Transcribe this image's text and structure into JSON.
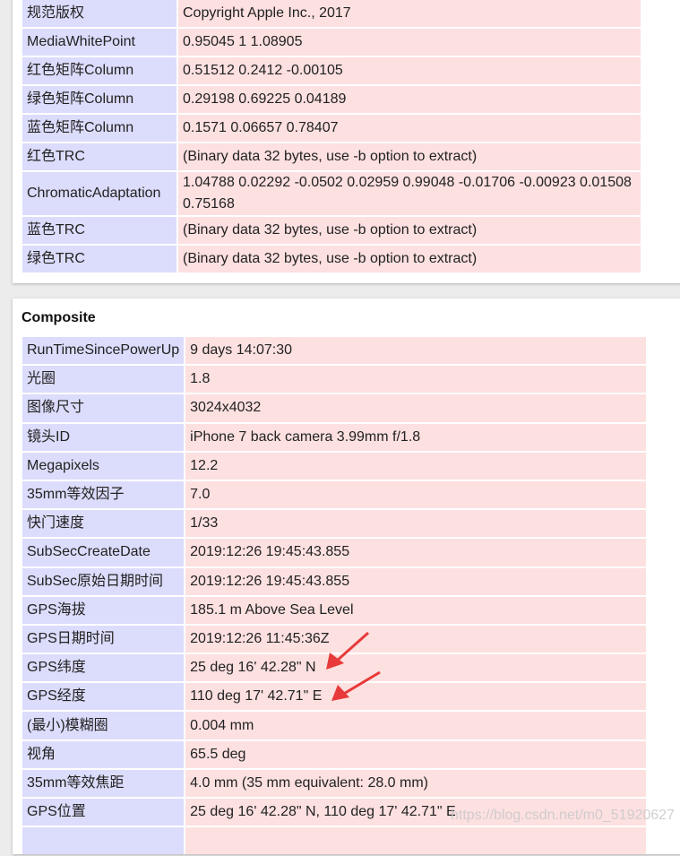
{
  "icc_rows": [
    {
      "key": "规范版权",
      "value": "Copyright Apple Inc., 2017"
    },
    {
      "key": "MediaWhitePoint",
      "value": "0.95045 1 1.08905"
    },
    {
      "key": "红色矩阵Column",
      "value": "0.51512 0.2412 -0.00105"
    },
    {
      "key": "绿色矩阵Column",
      "value": "0.29198 0.69225 0.04189"
    },
    {
      "key": "蓝色矩阵Column",
      "value": "0.1571 0.06657 0.78407"
    },
    {
      "key": "红色TRC",
      "value": "(Binary data 32 bytes, use -b option to extract)"
    },
    {
      "key": "ChromaticAdaptation",
      "value": "1.04788 0.02292 -0.0502 0.02959 0.99048 -0.01706 -0.00923 0.01508 0.75168"
    },
    {
      "key": "蓝色TRC",
      "value": "(Binary data 32 bytes, use -b option to extract)"
    },
    {
      "key": "绿色TRC",
      "value": "(Binary data 32 bytes, use -b option to extract)"
    }
  ],
  "composite": {
    "title": "Composite",
    "rows": [
      {
        "key": "RunTimeSincePowerUp",
        "value": "9 days 14:07:30"
      },
      {
        "key": "光圈",
        "value": "1.8"
      },
      {
        "key": "图像尺寸",
        "value": "3024x4032"
      },
      {
        "key": "镜头ID",
        "value": "iPhone 7 back camera 3.99mm f/1.8"
      },
      {
        "key": "Megapixels",
        "value": "12.2"
      },
      {
        "key": "35mm等效因子",
        "value": "7.0"
      },
      {
        "key": "快门速度",
        "value": "1/33"
      },
      {
        "key": "SubSecCreateDate",
        "value": "2019:12:26 19:45:43.855"
      },
      {
        "key": "SubSec原始日期时间",
        "value": "2019:12:26 19:45:43.855"
      },
      {
        "key": "GPS海拔",
        "value": "185.1 m Above Sea Level"
      },
      {
        "key": "GPS日期时间",
        "value": "2019:12:26 11:45:36Z"
      },
      {
        "key": "GPS纬度",
        "value": "25 deg 16' 42.28\" N"
      },
      {
        "key": "GPS经度",
        "value": "110 deg 17' 42.71\" E"
      },
      {
        "key": "(最小)模糊圈",
        "value": "0.004 mm"
      },
      {
        "key": "视角",
        "value": "65.5 deg"
      },
      {
        "key": "35mm等效焦距",
        "value": "4.0 mm (35 mm equivalent: 28.0 mm)"
      },
      {
        "key": "GPS位置",
        "value": "25 deg 16' 42.28\" N, 110 deg 17' 42.71\" E"
      },
      {
        "key": "",
        "value": ""
      }
    ]
  },
  "watermark": "https://blog.csdn.net/m0_51920627",
  "colors": {
    "key_bg": "#dcdcfc",
    "value_bg": "#fde0e0",
    "arrow": "#e83a3a"
  }
}
